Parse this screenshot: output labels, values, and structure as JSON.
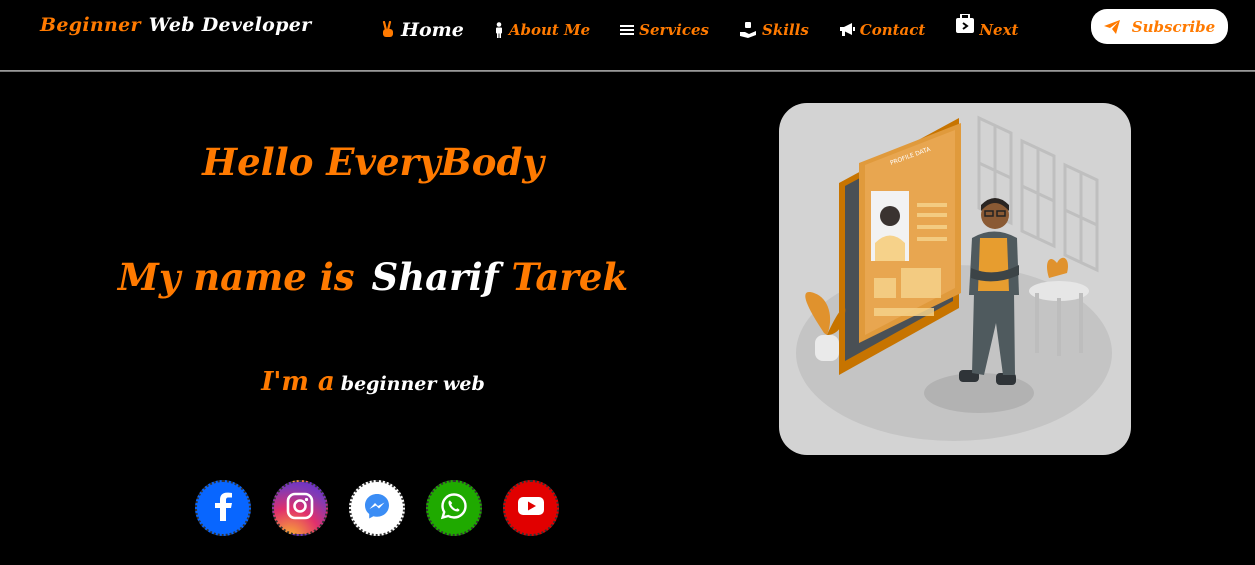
{
  "brand": {
    "part1": "Beginner",
    "part2": "Web Developer"
  },
  "nav": [
    {
      "label": "Home",
      "icon": "victory-hand-icon"
    },
    {
      "label": "About Me",
      "icon": "person-icon"
    },
    {
      "label": "Services",
      "icon": "list-icon"
    },
    {
      "label": "Skills",
      "icon": "hand-holding-icon"
    },
    {
      "label": "Contact",
      "icon": "megaphone-icon"
    },
    {
      "label": "Next",
      "icon": "briefcase-icon"
    }
  ],
  "subscribe": {
    "label": "Subscribe",
    "icon": "paper-plane-icon"
  },
  "hero": {
    "hello": "Hello EveryBody",
    "name_prefix": "My name is",
    "name_first": "Sharif",
    "name_last": "Tarek",
    "im_prefix": "I'm a",
    "role": "beginner web"
  },
  "social": [
    {
      "name": "facebook-icon",
      "color": "#0866ff"
    },
    {
      "name": "instagram-icon",
      "color": "#e1306c"
    },
    {
      "name": "messenger-icon",
      "color": "#ffffff"
    },
    {
      "name": "whatsapp-icon",
      "color": "#1faa00"
    },
    {
      "name": "youtube-icon",
      "color": "#e10000"
    }
  ],
  "illustration": {
    "card_title": "PROFILE DATA"
  },
  "colors": {
    "accent": "#ff7a00",
    "background": "#000000",
    "text": "#ffffff"
  }
}
